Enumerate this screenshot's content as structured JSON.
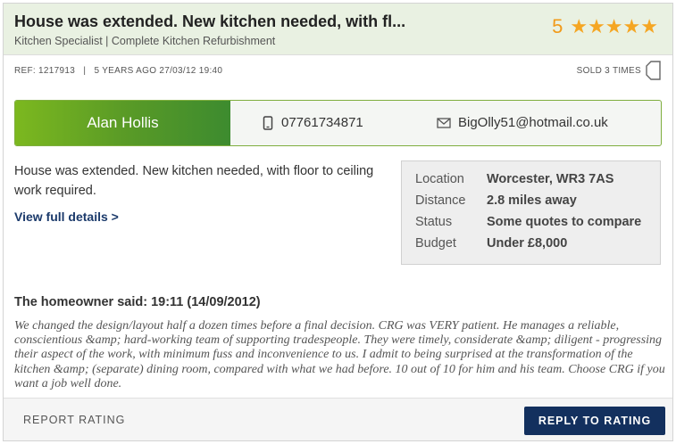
{
  "job": {
    "title": "House was extended. New kitchen needed, with fl...",
    "subtitle": "Kitchen Specialist | Complete Kitchen Refurbishment",
    "rating_value": "5",
    "rating_stars": 5,
    "meta": "REF: 1217913   |   5 YEARS AGO 27/03/12 19:40",
    "sold_label": "SOLD 3 TIMES"
  },
  "contact": {
    "name": "Alan Hollis",
    "phone": "07761734871",
    "email": "BigOlly51@hotmail.co.uk"
  },
  "description": {
    "text": "House was extended. New kitchen needed, with floor to ceiling work required.",
    "view_link": "View full details >"
  },
  "info": {
    "rows": [
      {
        "label": "Location",
        "value": "Worcester, WR3 7AS"
      },
      {
        "label": "Distance",
        "value": "2.8 miles away"
      },
      {
        "label": "Status",
        "value": "Some quotes to compare"
      },
      {
        "label": "Budget",
        "value": "Under £8,000"
      }
    ]
  },
  "review": {
    "heading": "The homeowner said: 19:11 (14/09/2012)",
    "text": "We changed the design/layout half a dozen times before a final decision. CRG was VERY patient. He manages a reliable, conscientious &amp; hard-working team of supporting tradespeople. They were timely, considerate &amp; diligent - progressing their aspect of the work, with minimum fuss and inconvenience to us. I admit to being surprised at the transformation of the kitchen &amp; (separate) dining room, compared with what we had before. 10 out of 10 for him and his team. Choose CRG if you want a job well done."
  },
  "footer": {
    "report_label": "REPORT RATING",
    "reply_label": "REPLY TO RATING"
  },
  "colors": {
    "star": "#f5a623",
    "rating_number": "#f19a1a",
    "header_bg": "#e9f1e2",
    "contact_green_start": "#7cb81f",
    "contact_green_end": "#3d8b2f",
    "link": "#1b3a6b",
    "reply_button": "#13305e"
  }
}
